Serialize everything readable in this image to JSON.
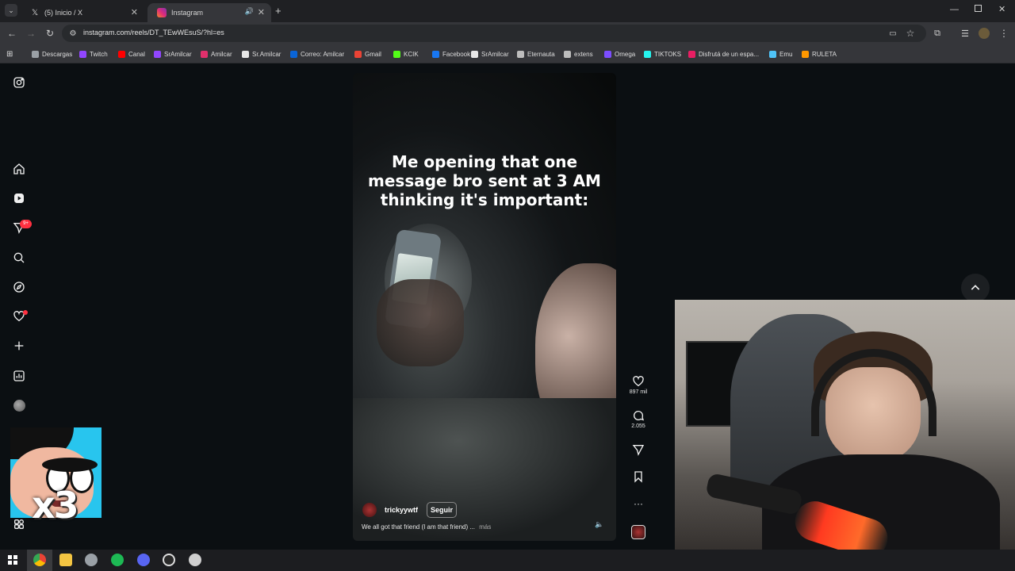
{
  "browser": {
    "tabs": [
      {
        "title": "(5) Inicio / X",
        "icon": "x-icon"
      },
      {
        "title": "Instagram",
        "icon": "instagram-icon"
      }
    ],
    "url": "instagram.com/reels/DT_TEwWEsuS/?hl=es",
    "bookmarks": [
      {
        "label": "Descargas",
        "color": "#9aa0a6"
      },
      {
        "label": "Twitch",
        "color": "#9146ff"
      },
      {
        "label": "Canal",
        "color": "#ff0000"
      },
      {
        "label": "SrAmilcar",
        "color": "#9146ff"
      },
      {
        "label": "Amilcar",
        "color": "#e1306c"
      },
      {
        "label": "Sr.Amilcar",
        "color": "#e8e8e8"
      },
      {
        "label": "Correo: Amilcar",
        "color": "#0a64d6"
      },
      {
        "label": "Gmail",
        "color": "#ea4335"
      },
      {
        "label": "KCIK",
        "color": "#53fc18"
      },
      {
        "label": "Facebook",
        "color": "#1877f2"
      },
      {
        "label": "SrAmilcar",
        "color": "#e8e8e8"
      },
      {
        "label": "Eternauta",
        "color": "#bdbdbd"
      },
      {
        "label": "extens",
        "color": "#bdbdbd"
      },
      {
        "label": "Omega",
        "color": "#7c4dff"
      },
      {
        "label": "TIKTOKS",
        "color": "#25f4ee"
      },
      {
        "label": "Disfrutá de un espa...",
        "color": "#e91e63"
      },
      {
        "label": "Emu",
        "color": "#4fc3f7"
      },
      {
        "label": "RULETA",
        "color": "#ff9800"
      }
    ]
  },
  "instagram": {
    "notification_badge": "9+",
    "reel": {
      "overlay_text_lines": [
        "Me opening that one",
        "message bro sent at 3 AM",
        "thinking it's important:"
      ],
      "username": "trickyywtf",
      "follow_label": "Seguir",
      "caption": "We all got that friend (I am that friend) ...",
      "more_label": "más",
      "likes": "897 mil",
      "comments": "2.055"
    }
  },
  "overlay": {
    "sticker_text": "x3"
  }
}
